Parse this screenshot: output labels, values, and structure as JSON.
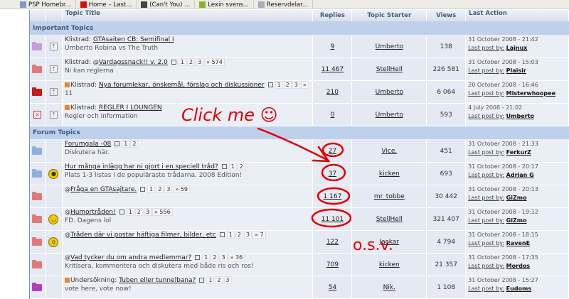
{
  "bookmarks": [
    {
      "label": "PSP Homebr...",
      "icon": "page-icon",
      "color": "#7a9cc6"
    },
    {
      "label": "Home – Last...",
      "icon": "lastfm-icon",
      "color": "#d51007"
    },
    {
      "label": "(Can't You) ...",
      "icon": "wikipedia-icon",
      "color": "#444"
    },
    {
      "label": "Lexin svens...",
      "icon": "lexin-icon",
      "color": "#8ab22a"
    },
    {
      "label": "Reservdelar...",
      "icon": "document-icon",
      "color": "#aab"
    }
  ],
  "header": {
    "title": "Topic Title",
    "replies": "Replies",
    "starter": "Topic Starter",
    "views": "Views",
    "last": "Last Action"
  },
  "sections": [
    {
      "title": "Important Topics",
      "rows": [
        {
          "folder": "#c99bd6",
          "pin": true,
          "prefix": "Klistrad: ",
          "attach": false,
          "poll": false,
          "title": "GTAsaiten CB: Semifinal I",
          "pages": [],
          "desc": "Umberto Robina vs The Truth",
          "replies": "9",
          "starter": "Umberto",
          "views": "138",
          "date": "31 October 2008 - 21:42",
          "last_user": "Lajnux"
        },
        {
          "folder": "#e07a7a",
          "pin": true,
          "prefix": "Klistrad: ",
          "attach": true,
          "poll": false,
          "title": "Vardagssnack!! v. 2.0",
          "pages": [
            "1",
            "2",
            "3",
            "» 574"
          ],
          "desc": "Ni kan reglerna",
          "replies": "11 467",
          "starter": "StellHell",
          "views": "226 581",
          "date": "31 October 2008 - 15:03",
          "last_user": "Plaisir"
        },
        {
          "folder": "#c41a1a",
          "pin": true,
          "prefix": "Klistrad: ",
          "attach": false,
          "poll": true,
          "title": "Nya forumlekar, önskemål, förslag och diskussioner",
          "pages": [
            "1",
            "2",
            "3",
            "»"
          ],
          "desc": "11",
          "replies": "210",
          "starter": "Umberto",
          "views": "6 064",
          "date": "20 October 2008 - 16:46",
          "last_user": "Misterwhoopee"
        },
        {
          "folder": "x",
          "pin": true,
          "prefix": "Klistrad: ",
          "attach": false,
          "poll": true,
          "title": "REGLER I LOUNGEN",
          "pages": [],
          "desc": "Regler och information",
          "replies": "0",
          "starter": "Umberto",
          "views": "593",
          "date": "4 July 2008 - 21:02",
          "last_user": "Umberto"
        }
      ]
    },
    {
      "title": "Forum Topics",
      "rows": [
        {
          "folder": "#8fb0de",
          "emoji": "",
          "prefix": "",
          "attach": false,
          "poll": false,
          "title": "Forumgala -08",
          "pages": [
            "1",
            "2"
          ],
          "desc": "Diskutera här.",
          "replies": "27",
          "starter": "Vice.",
          "views": "451",
          "date": "31 October 2008 - 21:33",
          "last_user": "FerkurZ"
        },
        {
          "folder": "#8fb0de",
          "emoji": "➔",
          "prefix": "",
          "attach": false,
          "poll": false,
          "title": "Hur många inlägg har ni gjort i en speciell tråd?",
          "pages": [
            "1",
            "2"
          ],
          "desc": "Plats 1-3 listas i de populäraste trådarna. 2008 Edition!",
          "replies": "37",
          "starter": "kicken",
          "views": "693",
          "date": "31 October 2008 - 20:17",
          "last_user": "Adrian G"
        },
        {
          "folder": "#e07a7a",
          "emoji": "",
          "prefix": "",
          "attach": true,
          "poll": false,
          "title": "Fråga en GTAsajtare.",
          "pages": [
            "1",
            "2",
            "3",
            "» 59"
          ],
          "desc": "",
          "replies": "1 167",
          "starter": "mr_tobbe",
          "views": "30 442",
          "date": "31 October 2008 - 20:13",
          "last_user": "GiZmo"
        },
        {
          "folder": "#e07a7a",
          "emoji": "😄",
          "prefix": "",
          "attach": true,
          "poll": false,
          "title": "Humortråden!",
          "pages": [
            "1",
            "2",
            "3",
            "» 556"
          ],
          "desc": "FD. Dagens lol",
          "replies": "11 101",
          "starter": "StellHell",
          "views": "321 407",
          "date": "31 October 2008 - 19:12",
          "last_user": "GiZmo"
        },
        {
          "folder": "#e07a7a",
          "emoji": "😲",
          "prefix": "",
          "attach": true,
          "poll": false,
          "title": "Tråden där vi postar häftiga filmer, bilder, etc",
          "pages": [
            "1",
            "2",
            "3",
            "» 7"
          ],
          "desc": "",
          "replies": "122",
          "starter": "Jackar",
          "views": "4 794",
          "date": "31 October 2008 - 18:15",
          "last_user": "RavenE"
        },
        {
          "folder": "#e07a7a",
          "emoji": "",
          "prefix": "",
          "attach": true,
          "poll": false,
          "title": "Vad tycker du om andra medlemmar?",
          "pages": [
            "1",
            "2",
            "3",
            "» 36"
          ],
          "desc": "Kritisera, kommentera och diskutera med både ris och ros!",
          "replies": "709",
          "starter": "kicken",
          "views": "21 357",
          "date": "31 October 2008 - 17:35",
          "last_user": "Mordos"
        },
        {
          "folder": "#b23fc0",
          "emoji": "",
          "prefix": "Undersökning: ",
          "attach": false,
          "poll": true,
          "title": "Tuben eller tunnelbana?",
          "pages": [
            "1",
            "2",
            "3"
          ],
          "desc": "vote here, vote now!",
          "replies": "54",
          "starter": "Nik.",
          "views": "1 108",
          "date": "31 October 2008 - 15:27",
          "last_user": "Eudoms"
        }
      ]
    }
  ],
  "last_post_label": "Last post by:",
  "annotations": {
    "click_me": "Click me ☺",
    "osv": "o.s.v.",
    "color": "#e00000"
  }
}
